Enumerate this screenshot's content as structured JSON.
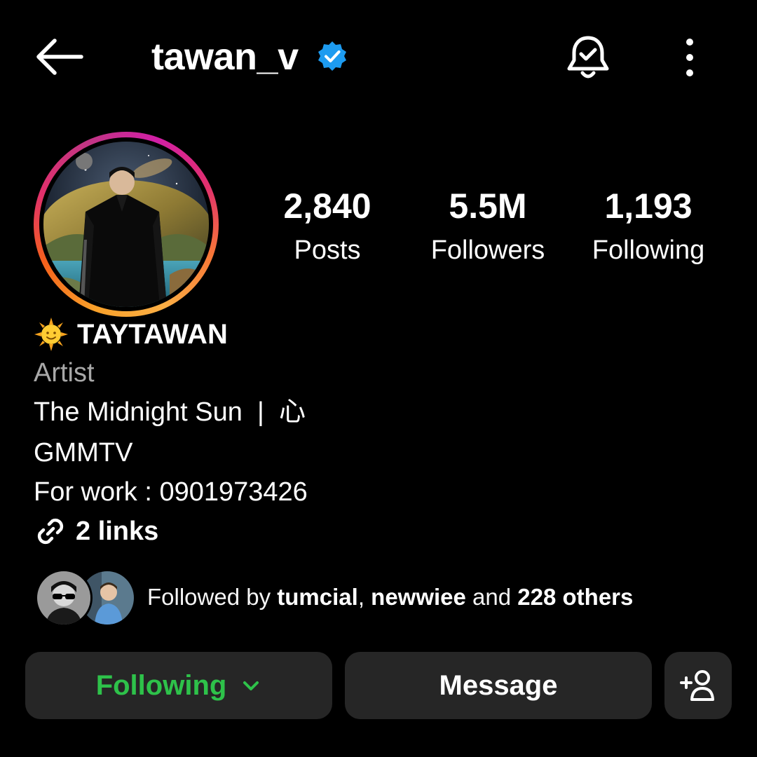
{
  "header": {
    "username": "tawan_v",
    "back_icon": "arrow-left-icon",
    "verified_icon": "verified-badge-icon",
    "notification_icon": "bell-check-icon",
    "more_icon": "more-vertical-icon"
  },
  "stats": [
    {
      "value": "2,840",
      "label": "Posts"
    },
    {
      "value": "5.5M",
      "label": "Followers"
    },
    {
      "value": "1,193",
      "label": "Following"
    }
  ],
  "profile": {
    "name_emoji": "🌞",
    "display_name": "TAYTAWAN",
    "category": "Artist",
    "bio_lines": [
      "The Midnight Sun  |  心",
      "GMMTV",
      "For work : 0901973426"
    ],
    "links_label": "2 links"
  },
  "mutuals": {
    "prefix": "Followed by ",
    "user1": "tumcial",
    "sep": ", ",
    "user2": "newwiee",
    "middle": " and ",
    "others": "228 others"
  },
  "actions": {
    "following_label": "Following",
    "message_label": "Message",
    "add_user_icon": "add-person-icon"
  },
  "colors": {
    "background": "#000000",
    "verified": "#1d9bf0",
    "following_text": "#2ec24a",
    "button_bg": "#262626",
    "category_gray": "#a8a8a8"
  }
}
